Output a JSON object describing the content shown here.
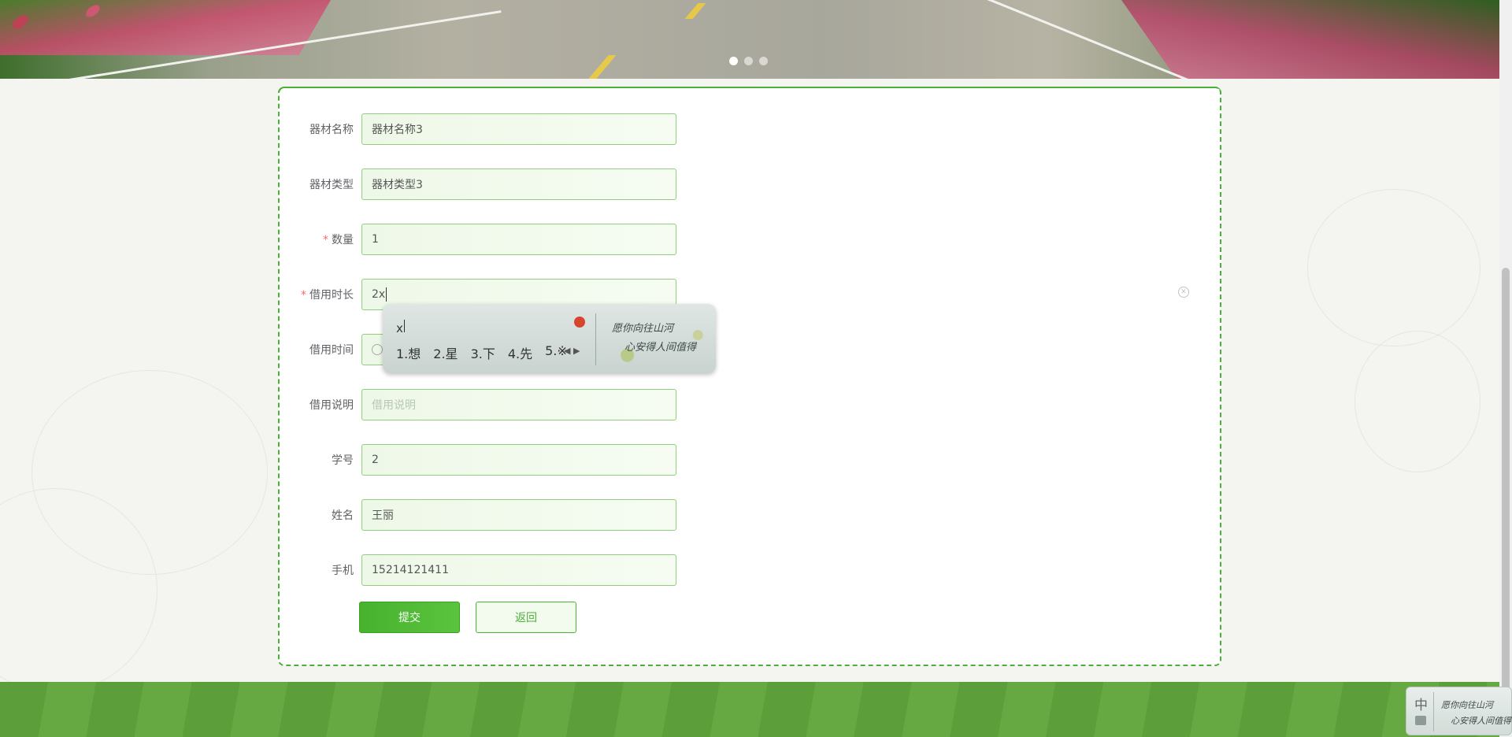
{
  "banner": {
    "slides": [
      "slide-1",
      "slide-2",
      "slide-3"
    ],
    "active_slide": 1
  },
  "form": {
    "fields": [
      {
        "label": "器材名称",
        "required": false,
        "value": "器材名称3",
        "placeholder": ""
      },
      {
        "label": "器材类型",
        "required": false,
        "value": "器材类型3",
        "placeholder": ""
      },
      {
        "label": "数量",
        "required": true,
        "value": "1",
        "placeholder": ""
      },
      {
        "label": "借用时长",
        "required": true,
        "value": "2x",
        "placeholder": ""
      },
      {
        "label": "借用时间",
        "required": false,
        "value": "",
        "placeholder": ""
      },
      {
        "label": "借用说明",
        "required": false,
        "value": "",
        "placeholder": "借用说明"
      },
      {
        "label": "学号",
        "required": false,
        "value": "2",
        "placeholder": ""
      },
      {
        "label": "姓名",
        "required": false,
        "value": "王丽",
        "placeholder": ""
      },
      {
        "label": "手机",
        "required": false,
        "value": "15214121411",
        "placeholder": ""
      }
    ],
    "required_mark": "*",
    "submit_label": "提交",
    "back_label": "返回"
  },
  "ime": {
    "composition": "x",
    "candidates": [
      "1.想",
      "2.星",
      "3.下",
      "4.先",
      "5.※"
    ],
    "skin_text_1": "愿你向往山河",
    "skin_text_2": "心安得人间值得",
    "status_mode": "中"
  },
  "colors": {
    "accent": "#4caf3a",
    "field_border": "#8fd17b",
    "required": "#f56c6c",
    "footer": "#5c9e3a"
  }
}
